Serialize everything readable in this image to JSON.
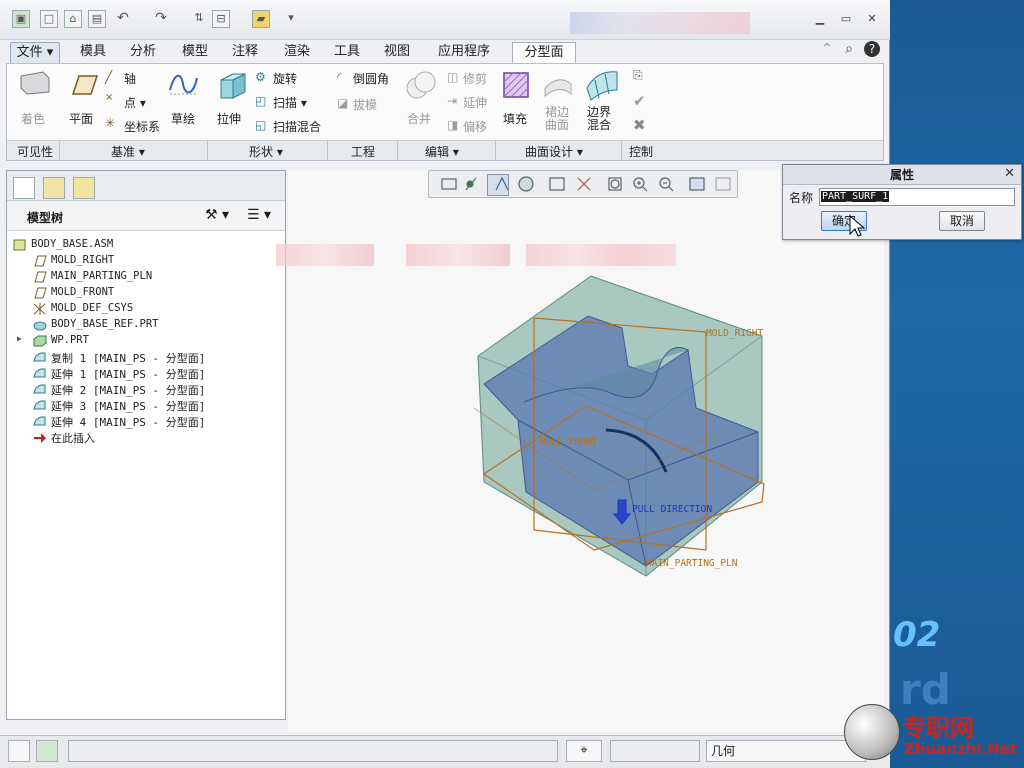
{
  "menu_tabs": [
    "文件",
    "模具",
    "分析",
    "模型",
    "注释",
    "渲染",
    "工具",
    "视图",
    "应用程序",
    "分型面"
  ],
  "ribbon": {
    "shading": "着色",
    "plane": "平面",
    "axis": "轴",
    "point": "点",
    "csys": "坐标系",
    "sketch": "草绘",
    "extrude": "拉伸",
    "revolve": "旋转",
    "sweep": "扫描",
    "swept_blend": "扫描混合",
    "round": "倒圆角",
    "draft": "拔模",
    "merge": "合并",
    "trim": "修剪",
    "extend": "延伸",
    "offset": "偏移",
    "fill": "填充",
    "skirt_surface": "裙边\n曲面",
    "boundary_blend": "边界\n混合"
  },
  "groups": [
    "可见性",
    "基准",
    "形状",
    "工程",
    "编辑",
    "曲面设计",
    "控制"
  ],
  "model_tree": {
    "title": "模型树",
    "items": [
      {
        "label": "BODY_BASE.ASM",
        "icon": "assembly-icon",
        "indent": 0
      },
      {
        "label": "MOLD_RIGHT",
        "icon": "datum-plane-icon",
        "indent": 1
      },
      {
        "label": "MAIN_PARTING_PLN",
        "icon": "datum-plane-icon",
        "indent": 1
      },
      {
        "label": "MOLD_FRONT",
        "icon": "datum-plane-icon",
        "indent": 1
      },
      {
        "label": "MOLD_DEF_CSYS",
        "icon": "csys-icon",
        "indent": 1
      },
      {
        "label": "BODY_BASE_REF.PRT",
        "icon": "part-icon",
        "indent": 1
      },
      {
        "label": "WP.PRT",
        "icon": "workpiece-icon",
        "indent": 1,
        "expandable": true
      },
      {
        "label": "复制 1 [MAIN_PS - 分型面]",
        "icon": "surface-icon",
        "indent": 1
      },
      {
        "label": "延伸 1 [MAIN_PS - 分型面]",
        "icon": "surface-icon",
        "indent": 1
      },
      {
        "label": "延伸 2 [MAIN_PS - 分型面]",
        "icon": "surface-icon",
        "indent": 1
      },
      {
        "label": "延伸 3 [MAIN_PS - 分型面]",
        "icon": "surface-icon",
        "indent": 1
      },
      {
        "label": "延伸 4 [MAIN_PS - 分型面]",
        "icon": "surface-icon",
        "indent": 1
      },
      {
        "label": "在此插入",
        "icon": "insert-here-icon",
        "indent": 1
      }
    ]
  },
  "viewport": {
    "labels": {
      "mold_right": "MOLD_RIGHT",
      "mold_front": "MOLD_FRONT",
      "pull_direction": "PULL DIRECTION",
      "main_parting_pln": "MAIN_PARTING_PLN"
    }
  },
  "dialog": {
    "title": "属性",
    "name_label": "名称",
    "name_value": "PART_SURF_1",
    "ok_label": "确定",
    "cancel_label": "取消"
  },
  "status": {
    "filter": "几何"
  },
  "desktop": {
    "text": "02",
    "text2": "rd",
    "watermark_title": "专职网",
    "watermark_url": "Zhuanzhi.Net"
  },
  "colors": {
    "accent": "#3c78c7",
    "model_fill": "#6f9f9a",
    "model_blue": "#4f6faa",
    "datum_orange": "#b5701f",
    "pull_blue": "#1d35c0"
  }
}
